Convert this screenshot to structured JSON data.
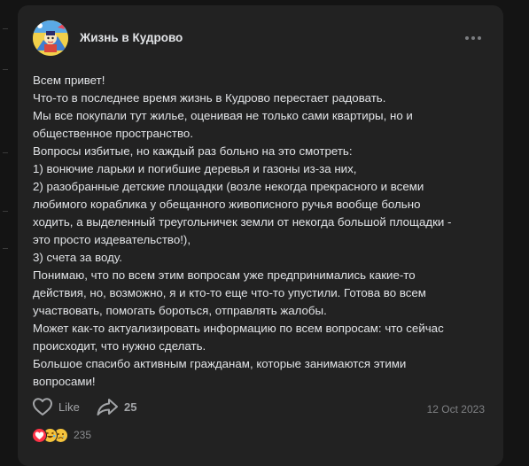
{
  "post": {
    "author": "Жизнь в Кудрово",
    "lines": [
      "Всем привет!",
      "Что-то в последнее время жизнь в Кудрово перестает радовать.",
      "Мы все покупали тут жилье, оценивая не только сами квартиры, но и",
      "общественное пространство.",
      "Вопросы избитые, но каждый раз больно на это смотреть:",
      "1) вонючие ларьки и погибшие деревья и газоны из-за них,",
      "2) разобранные детские площадки (возле некогда прекрасного и всеми",
      "любимого кораблика у обещанного живописного ручья вообще больно",
      "ходить, а выделенный треугольничек земли от некогда большой площадки -",
      "это просто издевательство!),",
      "3) счета за воду.",
      "Понимаю, что по всем этим вопросам уже предпринимались какие-то",
      "действия, но, возможно, я и кто-то еще что-то упустили. Готова во всем",
      "участвовать, помогать бороться, отправлять жалобы.",
      "Может как-то актуализировать информацию по всем вопросам: что сейчас",
      "происходит, что нужно сделать.",
      "Большое спасибо активным гражданам, которые занимаются этими",
      "вопросами!"
    ],
    "like_label": "Like",
    "share_count": "25",
    "date": "12 Oct 2023",
    "reactions_count": "235",
    "reaction_icons": [
      "heart-reaction-icon",
      "laughing-reaction-icon",
      "sad-reaction-icon"
    ]
  },
  "colors": {
    "background": "#141414",
    "card": "#222222",
    "text": "#e1e3e6",
    "muted": "#a3a5a8",
    "heart": "#ff3347",
    "emoji_yellow": "#f5c33b"
  }
}
